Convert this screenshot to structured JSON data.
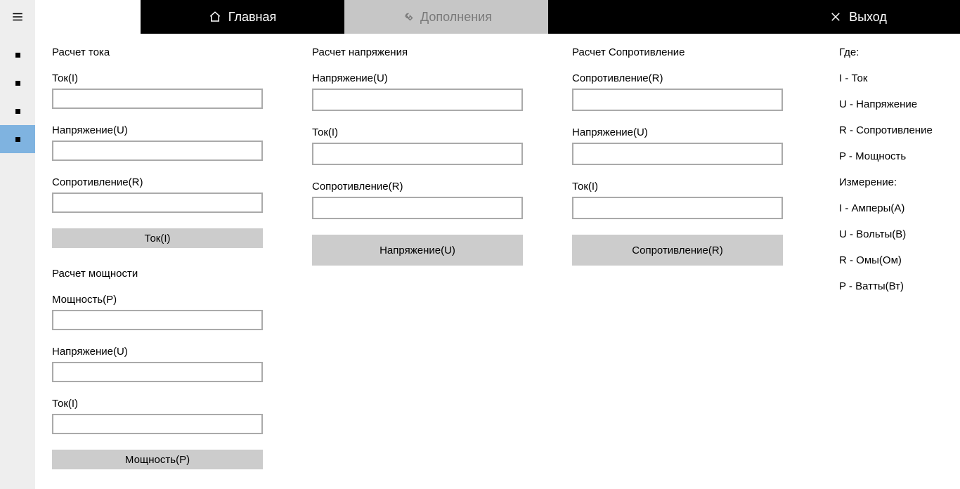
{
  "topbar": {
    "home_label": "Главная",
    "addons_label": "Дополнения",
    "exit_label": "Выход"
  },
  "sections": {
    "current": {
      "title": "Расчет тока",
      "f1": "Ток(I)",
      "f2": "Напряжение(U)",
      "f3": "Сопротивление(R)",
      "btn": "Ток(I)"
    },
    "voltage": {
      "title": "Расчет напряжения",
      "f1": "Напряжение(U)",
      "f2": "Ток(I)",
      "f3": "Сопротивление(R)",
      "btn": "Напряжение(U)"
    },
    "resistance": {
      "title": "Расчет Сопротивление",
      "f1": "Сопротивление(R)",
      "f2": "Напряжение(U)",
      "f3": "Ток(I)",
      "btn": "Сопротивление(R)"
    },
    "power": {
      "title": "Расчет мощности",
      "f1": "Мощность(P)",
      "f2": "Напряжение(U)",
      "f3": "Ток(I)",
      "btn": "Мощность(P)"
    }
  },
  "legend": {
    "where": "Где:",
    "i": "I - Ток",
    "u": "U - Напряжение",
    "r": "R - Сопротивление",
    "p": "P - Мощность",
    "meas": "Измерение:",
    "ia": "I - Амперы(А)",
    "uv": "U - Вольты(В)",
    "ro": "R - Омы(Ом)",
    "pw": "P - Ватты(Вт)"
  }
}
